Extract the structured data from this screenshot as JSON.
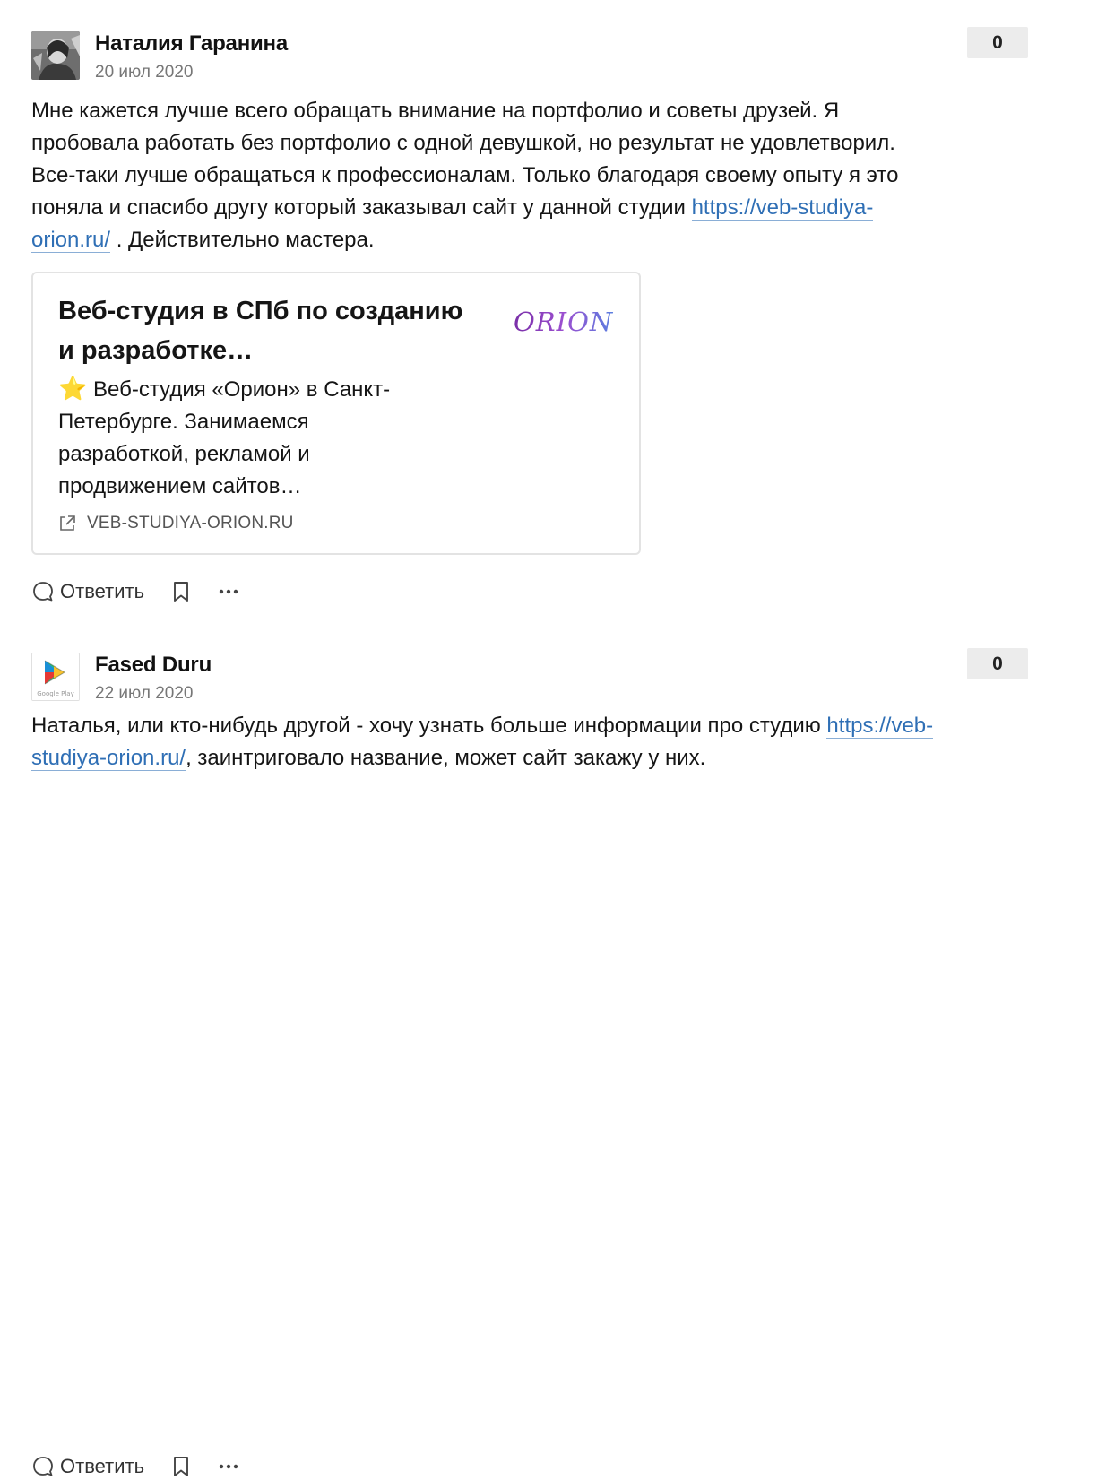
{
  "comments": [
    {
      "author": "Наталия Гаранина",
      "date": "20 июл 2020",
      "score": "0",
      "avatar_icon": "user-photo-avatar",
      "text_before": "Мне кажется лучше всего обращать внимание на портфолио и советы друзей. Я пробовала работать без портфолио с одной девушкой, но результат не удовлетворил. Все-таки лучше обращаться к профессионалам. Только благодаря своему опыту я это поняла и спасибо другу который заказывал сайт у данной студии ",
      "link": "https://veb-studiya-orion.ru/",
      "text_after": " . Действительно мастера.",
      "card": {
        "title": "Веб-студия в СПб по созданию и разработке…",
        "star": "⭐",
        "description": " Веб-студия «Орион» в Санкт-Петербурге. Занимаемся разработкой, рекламой и продвижением сайтов…",
        "logo_text": "ORION",
        "domain": "VEB-STUDIYA-ORION.RU"
      },
      "reply_label": "Ответить"
    },
    {
      "author": "Fased Duru",
      "date": "22 июл 2020",
      "score": "0",
      "avatar_icon": "google-play-icon",
      "avatar_caption": "Google Play",
      "text_before": "Наталья, или кто-нибудь другой - хочу узнать больше информации про студию ",
      "link": "https://veb-studiya-orion.ru/",
      "text_after": ", заинтриговало название, может сайт закажу у них.",
      "reply_label": "Ответить"
    }
  ],
  "colors": {
    "link": "#2f6fb5",
    "score_bg": "#ececec",
    "date": "#777777"
  }
}
